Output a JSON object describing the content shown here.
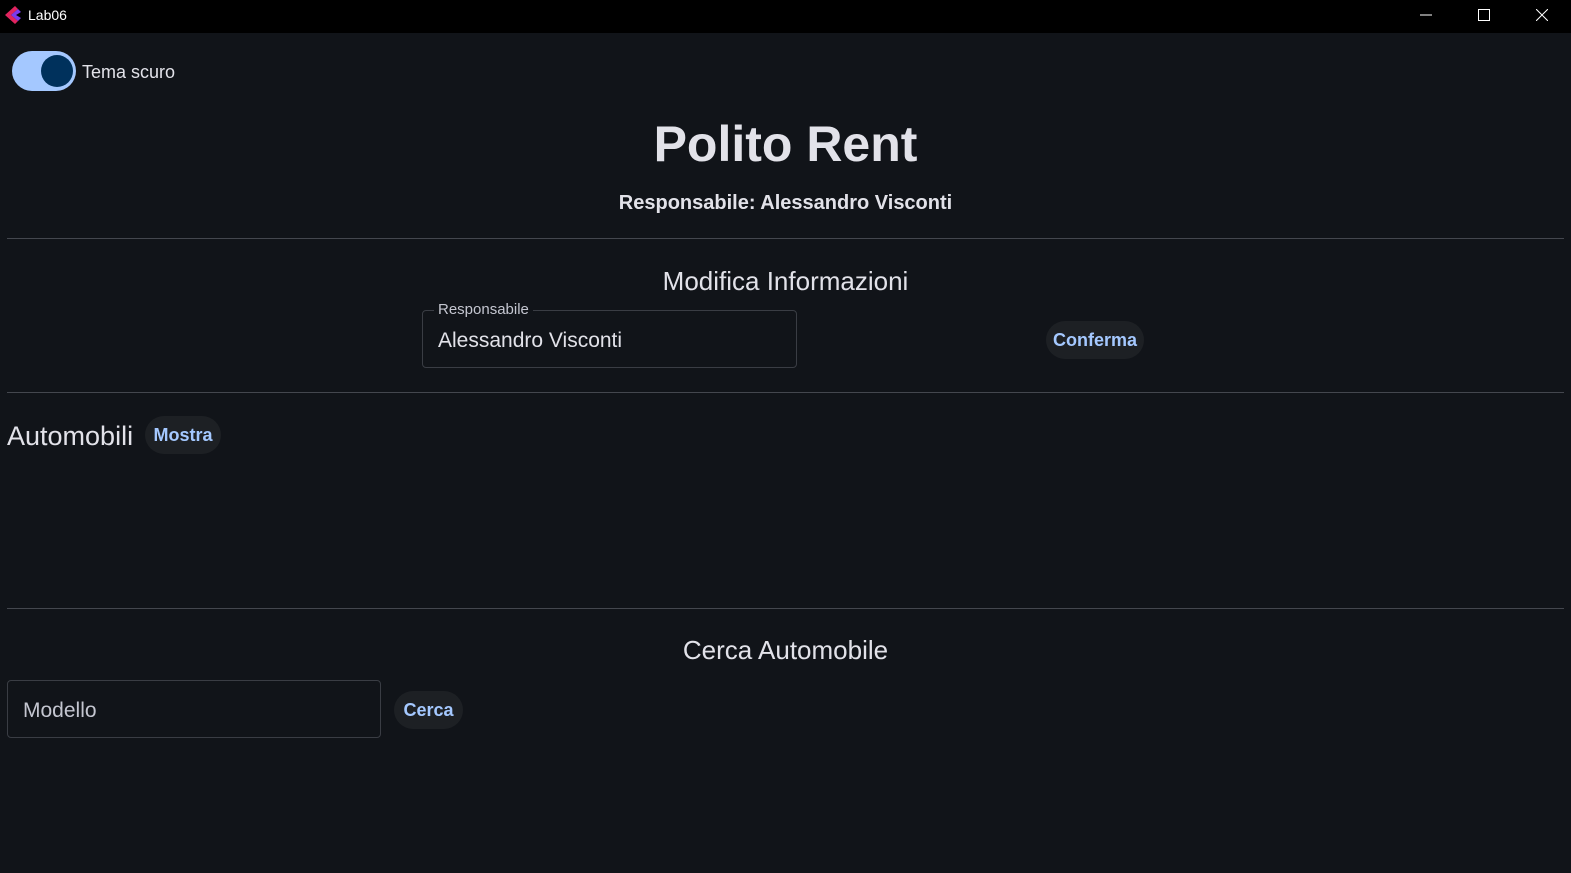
{
  "window": {
    "title": "Lab06",
    "icon": "flet-logo-icon",
    "controls": [
      "minimize-icon",
      "maximize-icon",
      "close-icon"
    ]
  },
  "theme_toggle": {
    "label": "Tema scuro",
    "checked": true
  },
  "header": {
    "title": "Polito Rent",
    "manager_line": "Responsabile: Alessandro Visconti"
  },
  "edit_section": {
    "title": "Modifica Informazioni",
    "manager_field": {
      "label": "Responsabile",
      "value": "Alessandro Visconti"
    },
    "confirm_label": "Conferma"
  },
  "cars_section": {
    "title": "Automobili",
    "show_label": "Mostra",
    "items": []
  },
  "search_section": {
    "title": "Cerca Automobile",
    "model_field": {
      "placeholder": "Modello",
      "value": ""
    },
    "search_label": "Cerca"
  },
  "colors": {
    "background": "#111419",
    "titlebar": "#000000",
    "primary": "#a4c8ff",
    "on_primary": "#00315c",
    "text": "#e2e2e9",
    "divider": "#44474e",
    "button_surface": "#1d2024"
  }
}
